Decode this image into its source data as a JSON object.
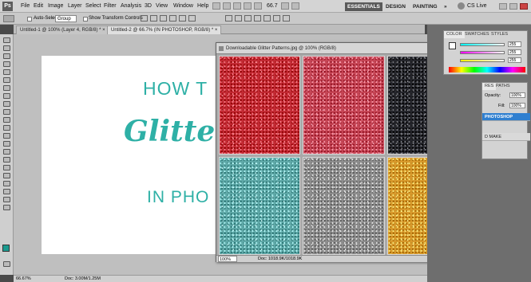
{
  "app": {
    "logo": "Ps"
  },
  "menubar": {
    "items": [
      "File",
      "Edit",
      "Image",
      "Layer",
      "Select",
      "Filter",
      "Analysis",
      "3D",
      "View",
      "Window",
      "Help"
    ],
    "zoom": "66.7",
    "workspaces": [
      "ESSENTIALS",
      "DESIGN",
      "PAINTING",
      "»"
    ],
    "cs_live": "CS Live"
  },
  "options": {
    "auto_select": "Auto-Select:",
    "auto_select_target": "Group",
    "transform_controls": "Show Transform Controls"
  },
  "tabs": [
    {
      "label": "Untitled-1 @ 100% (Layer 4, RGB/8) *"
    },
    {
      "label": "Untitled-2 @ 66.7% (IN PHOTOSHOP, RGB/8) *"
    }
  ],
  "canvas": {
    "line1": "HOW T",
    "line2": "Glitte",
    "line3": "IN PHO"
  },
  "status": {
    "zoom": "66.67%",
    "doc": "Doc: 3.00M/1.25M"
  },
  "floating": {
    "title": "Downloadable Glitter Patterns.jpg @ 100% (RGB/8)",
    "zoom": "100%",
    "doc": "Doc: 1018.9K/1018.9K"
  },
  "swatches": [
    {
      "name": "red-glitter",
      "color": "#c42a34"
    },
    {
      "name": "pink-glitter",
      "color": "#c74656"
    },
    {
      "name": "black-glitter",
      "color": "#25262c"
    },
    {
      "name": "teal-glitter",
      "color": "#5fa9a8"
    },
    {
      "name": "silver-glitter",
      "color": "#8e8e8e"
    },
    {
      "name": "gold-glitter",
      "color": "#d99a2c"
    }
  ],
  "rightpanel": {
    "color_tabs": [
      "COLOR",
      "SWATCHES",
      "STYLES"
    ],
    "rgb_values": [
      "255",
      "255",
      "255"
    ],
    "layer_tabs": [
      "RES",
      "PATHS"
    ],
    "opacity_label": "Opacity:",
    "opacity_value": "100%",
    "fill_label": "Fill:",
    "fill_value": "100%",
    "layers": [
      "PHOTOSHOP",
      "D MAKE"
    ]
  },
  "colors": {
    "accent_teal": "#2eb0a6",
    "selected_layer": "#2f7fd0"
  }
}
